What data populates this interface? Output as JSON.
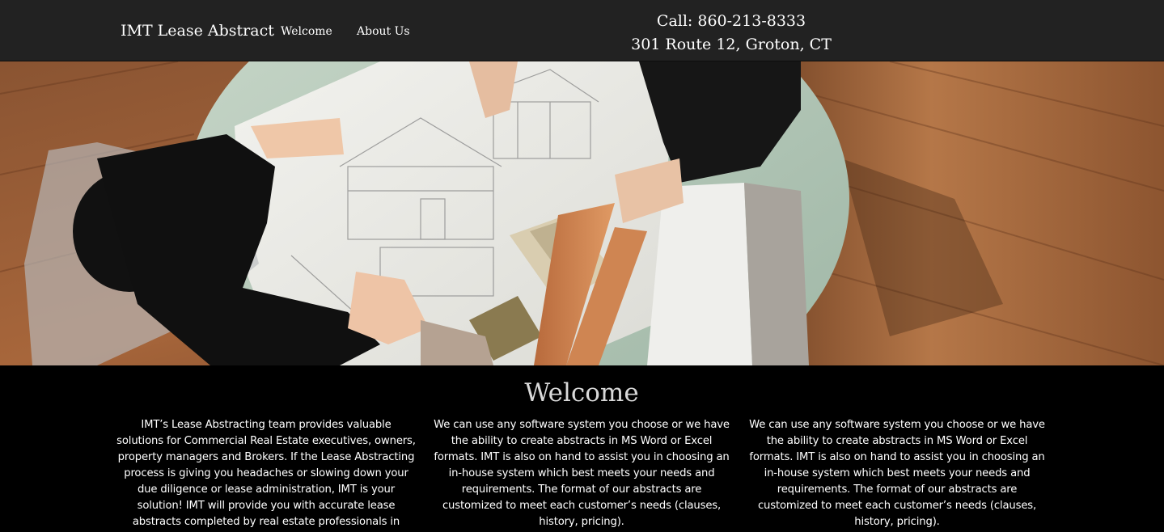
{
  "navbar": {
    "brand": "IMT Lease Abstract",
    "links": [
      {
        "label": "Welcome"
      },
      {
        "label": "About Us"
      }
    ],
    "contact": {
      "phone": "Call: 860-213-8333",
      "address": "301 Route 12, Groton, CT"
    },
    "background_color": "#222222"
  },
  "hero": {
    "image_subject": "two people reviewing architectural blueprints and material samples on a round table over a wooden floor"
  },
  "welcome": {
    "title": "Welcome",
    "columns": [
      {
        "text": "IMT’s Lease Abstracting team provides valuable solutions for Commercial Real Estate executives, owners, property managers and Brokers. If the Lease Abstracting process is giving you headaches or slowing down your due diligence or lease administration, IMT is your solution! IMT will provide you with accurate lease abstracts completed by real estate professionals in"
      },
      {
        "text": "We can use any software system you choose or we have the ability to create abstracts in MS Word or Excel formats. IMT is also on hand to assist you in choosing an in-house system which best meets your needs and requirements. The format of our abstracts are customized to meet each customer’s needs (clauses, history, pricing)."
      },
      {
        "text": "We can use any software system you choose or we have the ability to create abstracts in MS Word or Excel formats. IMT is also on hand to assist you in choosing an in-house system which best meets your needs and requirements. The format of our abstracts are customized to meet each customer’s needs (clauses, history, pricing)."
      }
    ]
  }
}
